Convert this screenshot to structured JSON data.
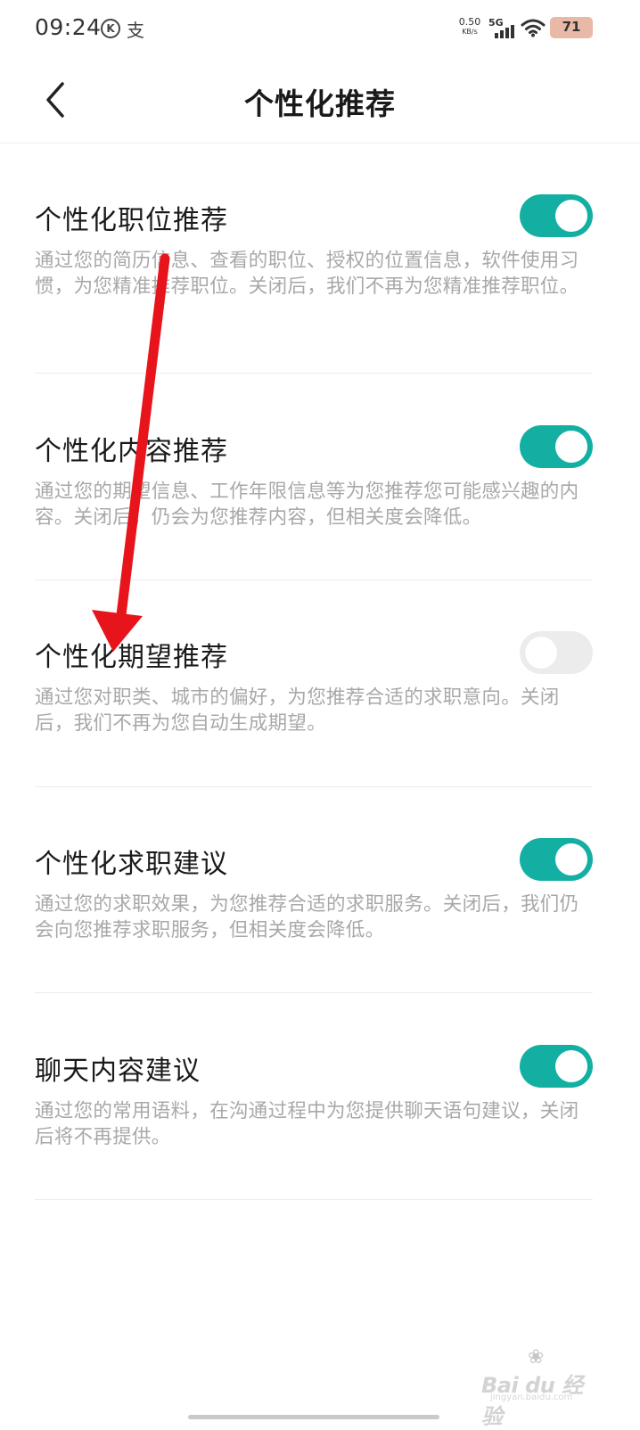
{
  "status_bar": {
    "time": "09:24",
    "k_icon_letter": "K",
    "alipay_icon_glyph": "支",
    "net_speed_value": "0.50",
    "net_speed_unit": "KB/s",
    "network": "5G",
    "battery": "71"
  },
  "nav": {
    "back_icon": "chevron-left-icon",
    "title": "个性化推荐"
  },
  "settings": [
    {
      "title": "个性化职位推荐",
      "description": "通过您的简历信息、查看的职位、授权的位置信息，软件使用习惯，为您精准推荐职位。关闭后，我们不再为您精准推荐职位。",
      "enabled": true
    },
    {
      "title": "个性化内容推荐",
      "description": "通过您的期望信息、工作年限信息等为您推荐您可能感兴趣的内容。关闭后，仍会为您推荐内容，但相关度会降低。",
      "enabled": true
    },
    {
      "title": "个性化期望推荐",
      "description": "通过您对职类、城市的偏好，为您推荐合适的求职意向。关闭后，我们不再为您自动生成期望。",
      "enabled": false
    },
    {
      "title": "个性化求职建议",
      "description": "通过您的求职效果，为您推荐合适的求职服务。关闭后，我们仍会向您推荐求职服务，但相关度会降低。",
      "enabled": true
    },
    {
      "title": "聊天内容建议",
      "description": "通过您的常用语料，在沟通过程中为您提供聊天语句建议，关闭后将不再提供。",
      "enabled": true
    }
  ],
  "colors": {
    "toggle_on": "#14afa3",
    "toggle_off": "#ececec",
    "annotation_arrow": "#e8141b"
  },
  "watermark": {
    "text": "Bai du 经验",
    "sub": "jingyan.baidu.com"
  }
}
